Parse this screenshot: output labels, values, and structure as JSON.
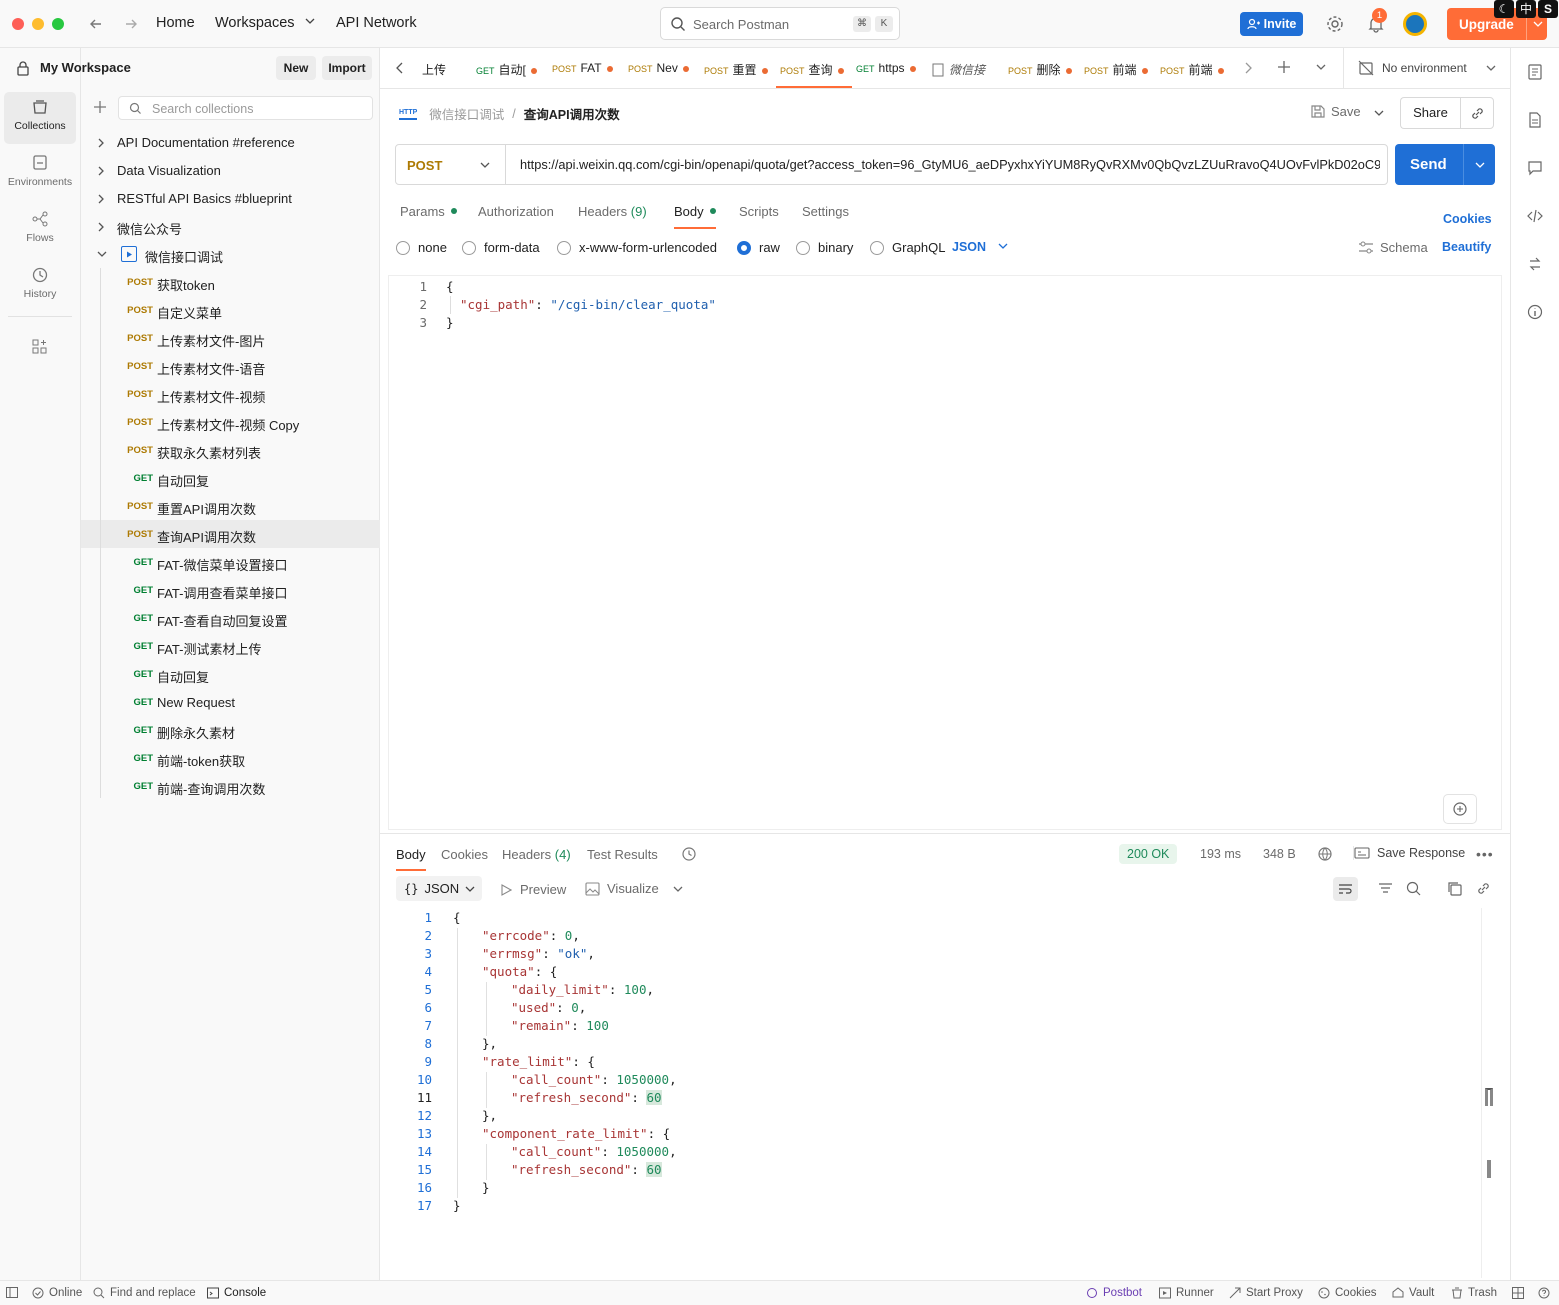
{
  "topbar": {
    "home": "Home",
    "workspaces": "Workspaces",
    "api_network": "API Network",
    "search_placeholder": "Search Postman",
    "kbd1": "⌘",
    "kbd2": "K",
    "invite": "Invite",
    "notif_count": "1",
    "upgrade": "Upgrade",
    "ime_badge": "中"
  },
  "rail": {
    "collections": "Collections",
    "environments": "Environments",
    "flows": "Flows",
    "history": "History"
  },
  "workspace": {
    "name": "My Workspace",
    "new": "New",
    "import": "Import",
    "search_placeholder": "Search collections"
  },
  "collections": [
    {
      "label": "API Documentation #reference"
    },
    {
      "label": "Data Visualization"
    },
    {
      "label": "RESTful API Basics #blueprint"
    },
    {
      "label": "微信公众号"
    },
    {
      "label": "微信接口调试"
    }
  ],
  "requests": [
    {
      "method": "POST",
      "label": "获取token"
    },
    {
      "method": "POST",
      "label": "自定义菜单"
    },
    {
      "method": "POST",
      "label": "上传素材文件-图片"
    },
    {
      "method": "POST",
      "label": "上传素材文件-语音"
    },
    {
      "method": "POST",
      "label": "上传素材文件-视频"
    },
    {
      "method": "POST",
      "label": "上传素材文件-视频 Copy"
    },
    {
      "method": "POST",
      "label": "获取永久素材列表"
    },
    {
      "method": "GET",
      "label": "自动回复"
    },
    {
      "method": "POST",
      "label": "重置API调用次数"
    },
    {
      "method": "POST",
      "label": "查询API调用次数"
    },
    {
      "method": "GET",
      "label": "FAT-微信菜单设置接口"
    },
    {
      "method": "GET",
      "label": "FAT-调用查看菜单接口"
    },
    {
      "method": "GET",
      "label": "FAT-查看自动回复设置"
    },
    {
      "method": "GET",
      "label": "FAT-测试素材上传"
    },
    {
      "method": "GET",
      "label": "自动回复"
    },
    {
      "method": "GET",
      "label": "New Request"
    },
    {
      "method": "GET",
      "label": "删除永久素材"
    },
    {
      "method": "GET",
      "label": "前端-token获取"
    },
    {
      "method": "GET",
      "label": "前端-查询调用次数"
    }
  ],
  "tabs": [
    {
      "method": "",
      "label": "上传"
    },
    {
      "method": "GET",
      "label": "自动["
    },
    {
      "method": "POST",
      "label": "FAT"
    },
    {
      "method": "POST",
      "label": "Nev"
    },
    {
      "method": "POST",
      "label": "重置"
    },
    {
      "method": "POST",
      "label": "查询"
    },
    {
      "method": "GET",
      "label": "https"
    },
    {
      "method": "",
      "label": "微信接"
    },
    {
      "method": "POST",
      "label": "删除"
    },
    {
      "method": "POST",
      "label": "前端"
    },
    {
      "method": "POST",
      "label": "前端"
    }
  ],
  "environment": "No environment",
  "breadcrumb": {
    "parent": "微信接口调试",
    "sep": "/",
    "current": "查询API调用次数",
    "http": "HTTP"
  },
  "actions": {
    "save": "Save",
    "share": "Share"
  },
  "request": {
    "method": "POST",
    "url": "https://api.weixin.qq.com/cgi-bin/openapi/quota/get?access_token=96_GtyMU6_aeDPyxhxYiYUM8RyQvRXMv0QbQvzLZUuRravoQ4UOvFvlPkD02oC9...",
    "send": "Send"
  },
  "req_tabs": {
    "params": "Params",
    "authorization": "Authorization",
    "headers": "Headers",
    "headers_count": "(9)",
    "body": "Body",
    "scripts": "Scripts",
    "settings": "Settings",
    "cookies": "Cookies"
  },
  "body_types": {
    "none": "none",
    "form_data": "form-data",
    "urlencoded": "x-www-form-urlencoded",
    "raw": "raw",
    "binary": "binary",
    "graphql": "GraphQL",
    "json": "JSON",
    "schema": "Schema",
    "beautify": "Beautify"
  },
  "request_body": {
    "l1": "{",
    "key": "\"cgi_path\"",
    "colon": ": ",
    "val": "\"/cgi-bin/clear_quota\"",
    "l3": "}"
  },
  "resp_tabs": {
    "body": "Body",
    "cookies": "Cookies",
    "headers": "Headers",
    "headers_count": "(4)",
    "tests": "Test Results"
  },
  "resp_meta": {
    "status": "200 OK",
    "time": "193 ms",
    "size": "348 B",
    "save_response": "Save Response"
  },
  "resp_view": {
    "format": "JSON",
    "preview": "Preview",
    "visualize": "Visualize"
  },
  "response_lines": [
    {
      "i": 0,
      "k": "",
      "v": "",
      "p": "{"
    },
    {
      "i": 1,
      "k": "\"errcode\"",
      "v": "0",
      "vt": "n",
      "p": ","
    },
    {
      "i": 1,
      "k": "\"errmsg\"",
      "v": "\"ok\"",
      "vt": "s",
      "p": ","
    },
    {
      "i": 1,
      "k": "\"quota\"",
      "v": "",
      "p": "{"
    },
    {
      "i": 2,
      "k": "\"daily_limit\"",
      "v": "100",
      "vt": "n",
      "p": ","
    },
    {
      "i": 2,
      "k": "\"used\"",
      "v": "0",
      "vt": "n",
      "p": ","
    },
    {
      "i": 2,
      "k": "\"remain\"",
      "v": "100",
      "vt": "n",
      "p": ""
    },
    {
      "i": 1,
      "k": "",
      "v": "",
      "p": "},"
    },
    {
      "i": 1,
      "k": "\"rate_limit\"",
      "v": "",
      "p": "{"
    },
    {
      "i": 2,
      "k": "\"call_count\"",
      "v": "1050000",
      "vt": "n",
      "p": ","
    },
    {
      "i": 2,
      "k": "\"refresh_second\"",
      "v": "60",
      "vt": "n",
      "p": "",
      "hl": true
    },
    {
      "i": 1,
      "k": "",
      "v": "",
      "p": "},"
    },
    {
      "i": 1,
      "k": "\"component_rate_limit\"",
      "v": "",
      "p": "{"
    },
    {
      "i": 2,
      "k": "\"call_count\"",
      "v": "1050000",
      "vt": "n",
      "p": ","
    },
    {
      "i": 2,
      "k": "\"refresh_second\"",
      "v": "60",
      "vt": "n",
      "p": "",
      "hl": true
    },
    {
      "i": 1,
      "k": "",
      "v": "",
      "p": "}"
    },
    {
      "i": 0,
      "k": "",
      "v": "",
      "p": "}"
    }
  ],
  "statusbar": {
    "online": "Online",
    "find_replace": "Find and replace",
    "console": "Console",
    "postbot": "Postbot",
    "runner": "Runner",
    "start_proxy": "Start Proxy",
    "cookies": "Cookies",
    "vault": "Vault",
    "trash": "Trash"
  }
}
